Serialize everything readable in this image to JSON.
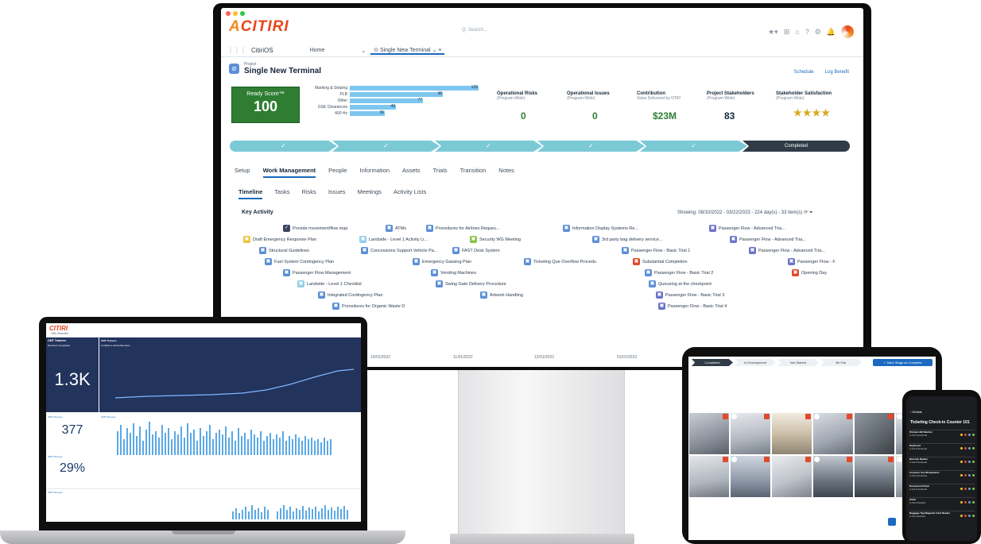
{
  "colors": {
    "brand": "#e8451a",
    "accent": "#1b6ac0",
    "ready": "#2e7d32",
    "path": "#7cc9d6"
  },
  "desktop": {
    "logo": "CITIRI",
    "search_placeholder": "Q. Search...",
    "app_name": "CitiriOS",
    "nav": {
      "home": "Home",
      "tab": "Single New Terminal"
    },
    "project": {
      "kind": "Project",
      "name": "Single New Terminal",
      "links": [
        "Schedule",
        "Log Benefit"
      ]
    },
    "ready": {
      "title": "Ready Score™",
      "value": "100"
    },
    "bars": [
      {
        "label": "Marking & Striping",
        "value": "135",
        "fraction": 1.0
      },
      {
        "label": "PLB",
        "value": "38",
        "fraction": 0.72
      },
      {
        "label": "Other",
        "value": "77",
        "fraction": 0.57
      },
      {
        "label": "GSE Clearances",
        "value": "49",
        "fraction": 0.36
      },
      {
        "label": "400 Hz",
        "value": "36",
        "fraction": 0.27
      }
    ],
    "kpis": [
      {
        "title": "Operational Risks",
        "sub": "(Program-Wide)",
        "value": "0"
      },
      {
        "title": "Operational Issues",
        "sub": "(Program-Wide)",
        "value": "0"
      },
      {
        "title": "Contribution",
        "sub": "Value Delivered by OTAT",
        "value": "$23M"
      },
      {
        "title": "Project Stakeholders",
        "sub": "(Program-Wide)",
        "value": "83"
      },
      {
        "title": "Stakeholder Satisfaction",
        "sub": "(Program-Wide)",
        "value": "★★★★"
      }
    ],
    "path_done": "Completed",
    "tabs": [
      "Setup",
      "Work Management",
      "People",
      "Information",
      "Assets",
      "Trials",
      "Transition",
      "Notes"
    ],
    "subtabs": [
      "Timeline",
      "Tasks",
      "Risks",
      "Issues",
      "Meetings",
      "Activity Lists"
    ],
    "key_activity": "Key Activity",
    "showing": "Showing: 08/10/2022 - 03/22/2023 - 224 day(s) - 33 item(s)",
    "activities": [
      "Provide movement/flow map",
      "ATMs",
      "Procedures for Airlines Reques...",
      "Information Display Systems Re...",
      "Passenger Flow - Advanced Tria...",
      "Draft Emergency Response Plan",
      "Landside - Level 1 Activity Li...",
      "Security WG Meeting",
      "3rd party bag delivery service...",
      "Passenger Flow - Advanced Tria...",
      "Structural Guidelines",
      "Concessions Support Vehicle Pa...",
      "FAST Desk System",
      "Passenger Flow - Basic Trial 1",
      "Passenger Flow - Advanced Tria...",
      "Fuel System Contingency Plan",
      "Emergency Gassing Plan",
      "Ticketing Que Overflow Procedu",
      "Substantial Completion",
      "Passenger Flow - F",
      "Passenger Flow Management",
      "Vending Machines",
      "Passenger Flow - Basic Trial 2",
      "Opening Day",
      "Landside - Level 1 Checklist",
      "Swing Gate Delivery Procedure",
      "Queueing at the checkpoint",
      "Integrated Contingency Plan",
      "Artwork Handling",
      "Passenger Flow - Basic Trial 3",
      "Procedures for Organic Waste D",
      "Passenger Flow - Basic Trial 4"
    ],
    "axis": [
      "10/01/2022",
      "11/01/2022",
      "12/01/2022",
      "01/01/2023"
    ]
  },
  "laptop": {
    "logo": "CITIRI",
    "app": "Citiri Describe",
    "tile1": {
      "title": "OMT Trainees",
      "sub": "Members Completed",
      "value": "1.3K"
    },
    "tile2": {
      "title": "OMT Trainees",
      "sub": "Certified in Actual Members"
    },
    "tile3": {
      "title": "OMT Surveys",
      "value": "377"
    },
    "tile4": {
      "title": "OMT Surveys",
      "value": "29%"
    },
    "tile5": {
      "title": "OMT Surveys"
    },
    "tile6": {
      "title": "OMT Surveys"
    }
  },
  "tablet": {
    "path": [
      "Completed",
      "In Development",
      "Not Started",
      "Be Fair"
    ],
    "mark": "Mark Stage as Complete"
  },
  "phone": {
    "title": "Ticketing Check-in Counter 101",
    "back": "Details",
    "rows": [
      {
        "name": "Printed LED Monitor",
        "status": "Not Functional"
      },
      {
        "name": "Keyboard",
        "status": "Not Functional"
      },
      {
        "name": "Barcode Reader",
        "status": "Not Functional"
      },
      {
        "name": "Common Use Workstation",
        "status": "Not Functional"
      },
      {
        "name": "Document Printer",
        "status": "Not Functional"
      },
      {
        "name": "HVAC",
        "status": "Not Checked"
      },
      {
        "name": "Baggage Tag Magnetic Card Reader",
        "status": "Not Checked"
      }
    ]
  }
}
